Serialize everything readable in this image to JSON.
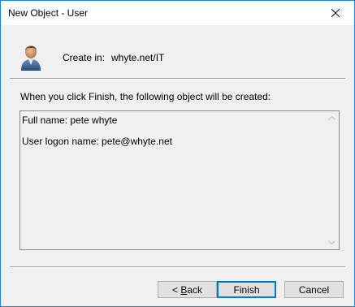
{
  "window": {
    "title": "New Object - User"
  },
  "header": {
    "create_in_label": "Create in:",
    "create_in_value": "whyte.net/IT",
    "icon": "user-icon"
  },
  "intro_text": "When you click Finish, the following object will be created:",
  "summary": {
    "full_name_line": "Full name: pete whyte",
    "logon_line": "User logon name: pete@whyte.net"
  },
  "buttons": {
    "back_prefix": "< ",
    "back_mnemonic": "B",
    "back_rest": "ack",
    "finish": "Finish",
    "cancel": "Cancel"
  },
  "colors": {
    "window_border": "#1883d7",
    "default_button_border": "#0078d7",
    "dialog_background": "#f0f0f0"
  }
}
